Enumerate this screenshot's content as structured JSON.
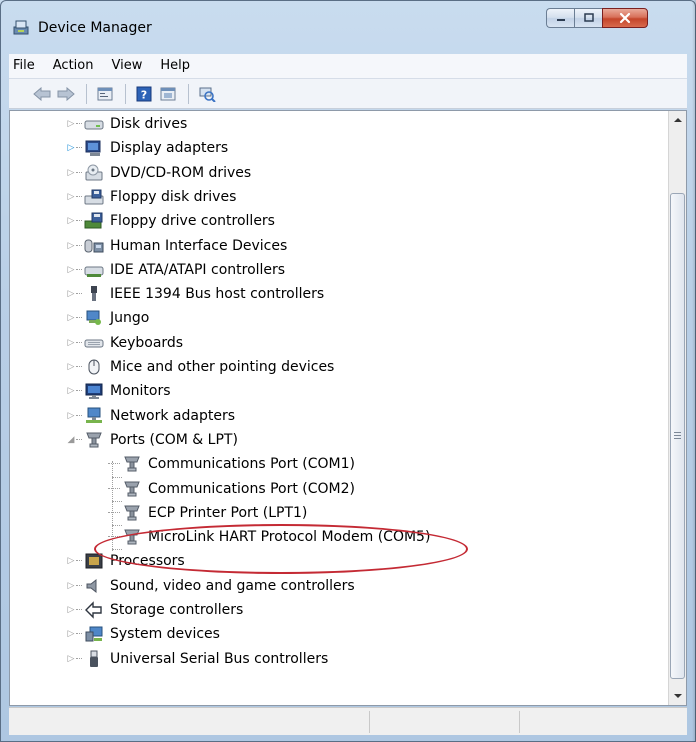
{
  "window": {
    "title": "Device Manager",
    "controls": [
      "minimize",
      "maximize",
      "close"
    ]
  },
  "menu": [
    "File",
    "Action",
    "View",
    "Help"
  ],
  "toolbar": {
    "buttons": [
      "back-arrow-icon",
      "forward-arrow-icon",
      "properties-icon",
      "help-icon",
      "show-hidden-icon",
      "scan-hardware-icon"
    ]
  },
  "tree": {
    "items": [
      {
        "label": "Disk drives",
        "icon": "disk-drive-icon",
        "expanded": false
      },
      {
        "label": "Display adapters",
        "icon": "display-adapter-icon",
        "expanded": false,
        "selected_indicator": true
      },
      {
        "label": "DVD/CD-ROM drives",
        "icon": "dvd-drive-icon",
        "expanded": false
      },
      {
        "label": "Floppy disk drives",
        "icon": "floppy-drive-icon",
        "expanded": false
      },
      {
        "label": "Floppy drive controllers",
        "icon": "floppy-controller-icon",
        "expanded": false
      },
      {
        "label": "Human Interface Devices",
        "icon": "hid-icon",
        "expanded": false
      },
      {
        "label": "IDE ATA/ATAPI controllers",
        "icon": "ide-controller-icon",
        "expanded": false
      },
      {
        "label": "IEEE 1394 Bus host controllers",
        "icon": "ieee1394-icon",
        "expanded": false
      },
      {
        "label": "Jungo",
        "icon": "jungo-icon",
        "expanded": false
      },
      {
        "label": "Keyboards",
        "icon": "keyboard-icon",
        "expanded": false
      },
      {
        "label": "Mice and other pointing devices",
        "icon": "mouse-icon",
        "expanded": false
      },
      {
        "label": "Monitors",
        "icon": "monitor-icon",
        "expanded": false
      },
      {
        "label": "Network adapters",
        "icon": "network-adapter-icon",
        "expanded": false
      },
      {
        "label": "Ports (COM & LPT)",
        "icon": "port-icon",
        "expanded": true,
        "children": [
          {
            "label": "Communications Port (COM1)",
            "icon": "port-icon"
          },
          {
            "label": "Communications Port (COM2)",
            "icon": "port-icon"
          },
          {
            "label": "ECP Printer Port (LPT1)",
            "icon": "port-icon"
          },
          {
            "label": "MicroLink HART Protocol Modem (COM5)",
            "icon": "port-icon",
            "highlighted": true
          }
        ]
      },
      {
        "label": "Processors",
        "icon": "processor-icon",
        "expanded": false
      },
      {
        "label": "Sound, video and game controllers",
        "icon": "sound-icon",
        "expanded": false
      },
      {
        "label": "Storage controllers",
        "icon": "storage-controller-icon",
        "expanded": false
      },
      {
        "label": "System devices",
        "icon": "system-devices-icon",
        "expanded": false
      },
      {
        "label": "Universal Serial Bus controllers",
        "icon": "usb-icon",
        "expanded": false
      }
    ]
  },
  "colors": {
    "highlight_ellipse": "#c42a34",
    "close_button": "#c4452a",
    "expander_active": "#1e8fd8"
  }
}
